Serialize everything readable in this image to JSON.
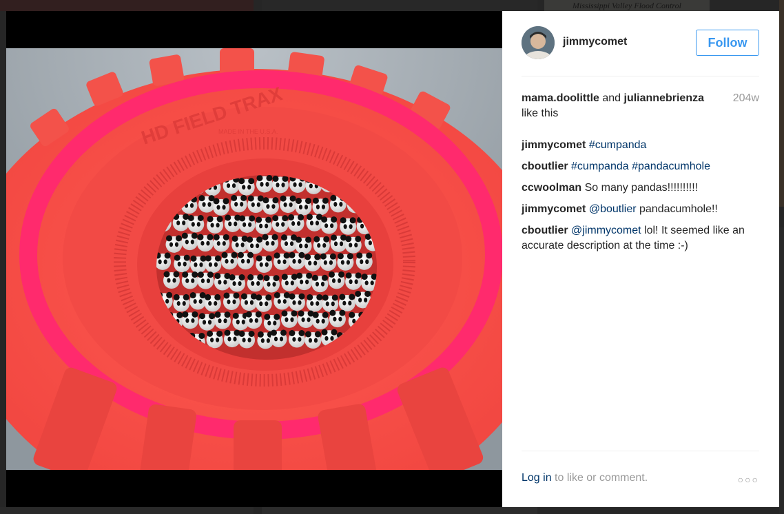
{
  "background": {
    "caption": "Mississippi Valley Flood Control"
  },
  "post": {
    "username": "jimmycomet",
    "follow_label": "Follow",
    "likes": {
      "user1": "mama.doolittle",
      "and": "and",
      "user2": "juliannebrienza",
      "suffix": "like this",
      "time": "204w"
    },
    "comments": [
      {
        "user": "jimmycomet",
        "parts": [
          {
            "t": "#cumpanda",
            "tag": true
          }
        ]
      },
      {
        "user": "cboutlier",
        "parts": [
          {
            "t": "#cumpanda",
            "tag": true
          },
          {
            "t": " ",
            "tag": false
          },
          {
            "t": "#pandacumhole",
            "tag": true
          }
        ]
      },
      {
        "user": "ccwoolman",
        "parts": [
          {
            "t": "So many pandas!!!!!!!!!!",
            "tag": false
          }
        ]
      },
      {
        "user": "jimmycomet",
        "parts": [
          {
            "t": "@boutlier",
            "tag": true
          },
          {
            "t": " pandacumhole!!",
            "tag": false
          }
        ]
      },
      {
        "user": "cboutlier",
        "parts": [
          {
            "t": "@jimmycomet",
            "tag": true
          },
          {
            "t": " lol! It seemed like an accurate description at the time :-)",
            "tag": false
          }
        ]
      }
    ],
    "footer": {
      "login_link": "Log in",
      "login_rest": " to like or comment.",
      "more_icon": "ellipsis-icon"
    },
    "photo_text": {
      "tire_brand": "HD FIELD TRAX",
      "tire_small": "MADE IN THE U.S.A."
    }
  },
  "colors": {
    "accent": "#3897f0",
    "link": "#003569",
    "muted": "#999999",
    "tire_red": "#f2504a",
    "tire_pink": "#ff2a6d"
  }
}
